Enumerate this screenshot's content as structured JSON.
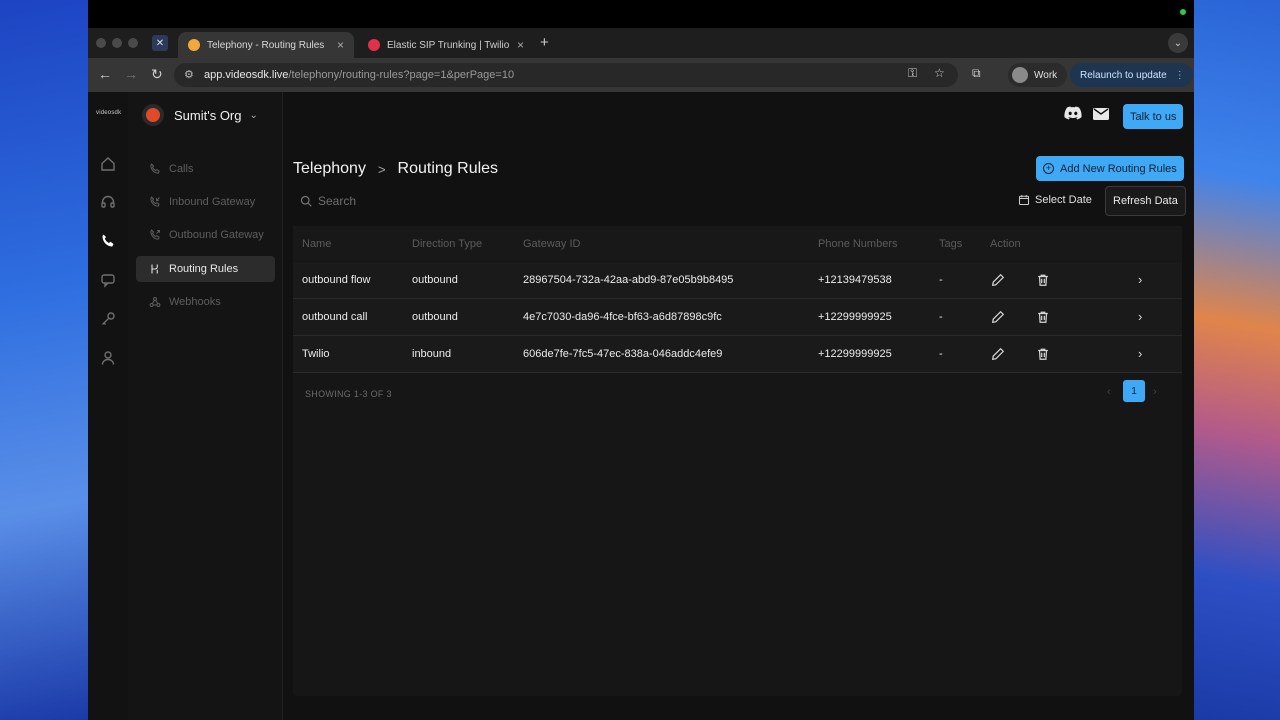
{
  "browser": {
    "tabs": [
      {
        "title": "Telephony - Routing Rules",
        "active": true
      },
      {
        "title": "Elastic SIP Trunking | Twilio C",
        "active": false
      }
    ],
    "url_host": "app.videosdk.live",
    "url_path": "/telephony/routing-rules?page=1&perPage=10",
    "profile_label": "Work",
    "relaunch_label": "Relaunch to update"
  },
  "app": {
    "logo_text": "videosdk",
    "org_name": "Sumit's Org",
    "talk_label": "Talk to us",
    "sidebar": {
      "items": [
        {
          "label": "Calls",
          "icon": "phone-icon"
        },
        {
          "label": "Inbound Gateway",
          "icon": "phone-incoming-icon"
        },
        {
          "label": "Outbound Gateway",
          "icon": "phone-outgoing-icon"
        },
        {
          "label": "Routing Rules",
          "icon": "routing-icon",
          "active": true
        },
        {
          "label": "Webhooks",
          "icon": "webhook-icon"
        }
      ]
    }
  },
  "main": {
    "breadcrumb_parent": "Telephony",
    "breadcrumb_current": "Routing Rules",
    "add_label": "Add New Routing Rules",
    "search_placeholder": "Search",
    "select_date_label": "Select Date",
    "refresh_label": "Refresh Data",
    "table": {
      "headers": [
        "Name",
        "Direction Type",
        "Gateway ID",
        "Phone Numbers",
        "Tags",
        "Action"
      ],
      "rows": [
        {
          "name": "outbound flow",
          "direction": "outbound",
          "gateway": "28967504-732a-42aa-abd9-87e05b9b8495",
          "phone": "+12139479538",
          "tags": "-"
        },
        {
          "name": "outbound call",
          "direction": "outbound",
          "gateway": "4e7c7030-da96-4fce-bf63-a6d87898c9fc",
          "phone": "+12299999925",
          "tags": "-"
        },
        {
          "name": "Twilio",
          "direction": "inbound",
          "gateway": "606de7fe-7fc5-47ec-838a-046addc4efe9",
          "phone": "+12299999925",
          "tags": "-"
        }
      ],
      "showing": "SHOWING 1-3 OF 3",
      "page": "1"
    }
  },
  "colors": {
    "accent": "#3fa9f5",
    "background": "#111111",
    "org_dot": "#e04a2a"
  }
}
